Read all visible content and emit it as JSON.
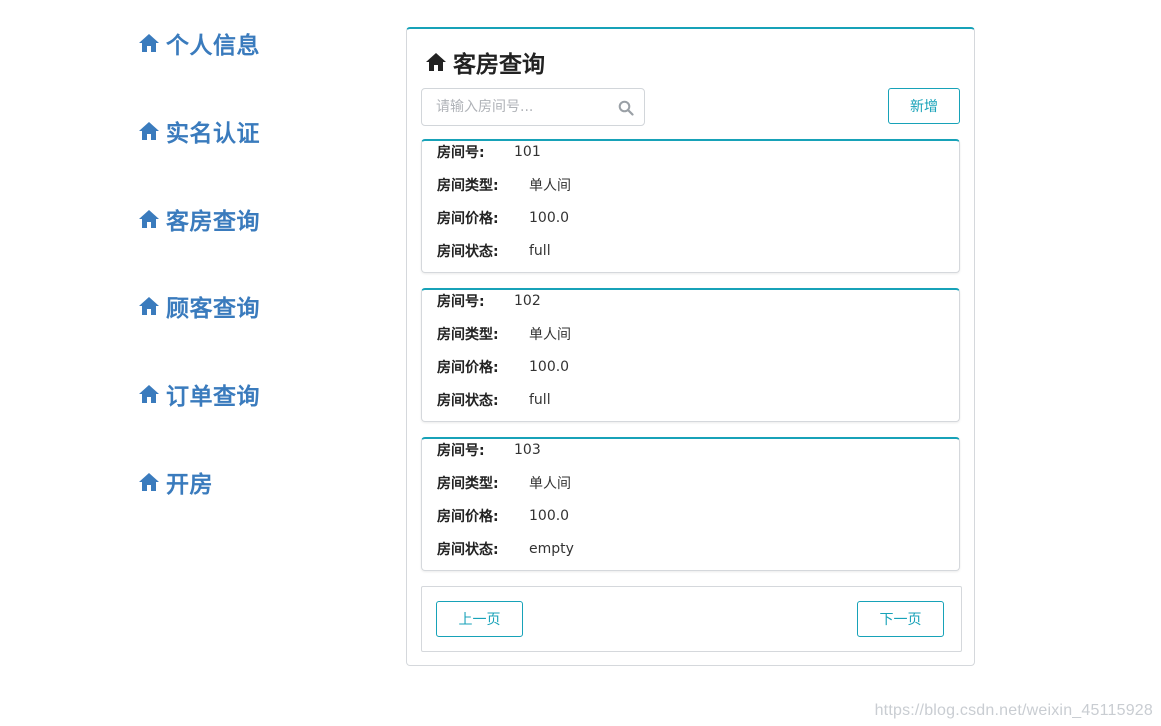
{
  "sidebar": {
    "items": [
      {
        "label": "个人信息",
        "icon": "home-icon"
      },
      {
        "label": "实名认证",
        "icon": "home-icon"
      },
      {
        "label": "客房查询",
        "icon": "home-icon"
      },
      {
        "label": "顾客查询",
        "icon": "home-icon"
      },
      {
        "label": "订单查询",
        "icon": "home-icon"
      },
      {
        "label": "开房",
        "icon": "home-icon"
      }
    ],
    "color": "#3a7bbd"
  },
  "panel": {
    "title": "客房查询",
    "accent_color": "#17a2b8"
  },
  "search": {
    "placeholder": "请输入房间号...",
    "value": ""
  },
  "toolbar": {
    "add_label": "新增"
  },
  "labels": {
    "room_no": "房间号:",
    "room_type": "房间类型:",
    "room_price": "房间价格:",
    "room_status": "房间状态:"
  },
  "rooms": [
    {
      "no": "101",
      "type": "单人间",
      "price": "100.0",
      "status": "full"
    },
    {
      "no": "102",
      "type": "单人间",
      "price": "100.0",
      "status": "full"
    },
    {
      "no": "103",
      "type": "单人间",
      "price": "100.0",
      "status": "empty"
    }
  ],
  "pagination": {
    "prev_label": "上一页",
    "next_label": "下一页"
  },
  "watermark": "https://blog.csdn.net/weixin_45115928"
}
